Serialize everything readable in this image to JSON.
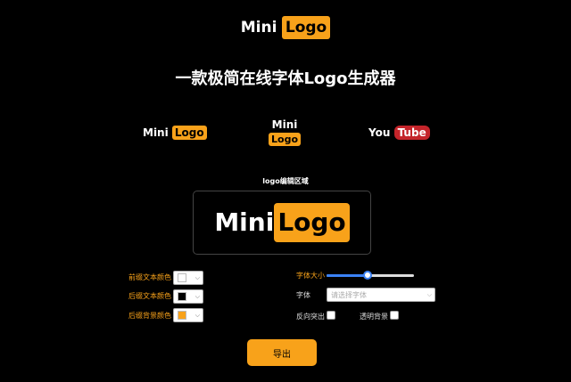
{
  "header": {
    "prefix": "Mini",
    "suffix": "Logo"
  },
  "tagline": "一款极简在线字体Logo生成器",
  "presets": [
    {
      "prefix": "Mini",
      "suffix": "Logo"
    },
    {
      "prefix": "Mini",
      "suffix": "Logo"
    },
    {
      "prefix": "You",
      "suffix": "Tube"
    }
  ],
  "editor": {
    "label": "logo编辑区域",
    "prefix": "Mini",
    "suffix": "Logo"
  },
  "controls": {
    "prefix_text_color_label": "前缀文本颜色",
    "suffix_text_color_label": "后缀文本颜色",
    "suffix_bg_color_label": "后缀背景颜色",
    "font_size_label": "字体大小",
    "font_label": "字体",
    "font_placeholder": "请选择字体",
    "reverse_label": "反向突出",
    "transparent_bg_label": "透明背景",
    "font_size_fraction": 0.47
  },
  "colors": {
    "accent": "#f8a21a",
    "prefix_text": "#ffffff",
    "suffix_text": "#000000",
    "suffix_bg": "#f8a21a",
    "youtube_red": "#c4242a"
  },
  "export_label": "导出"
}
